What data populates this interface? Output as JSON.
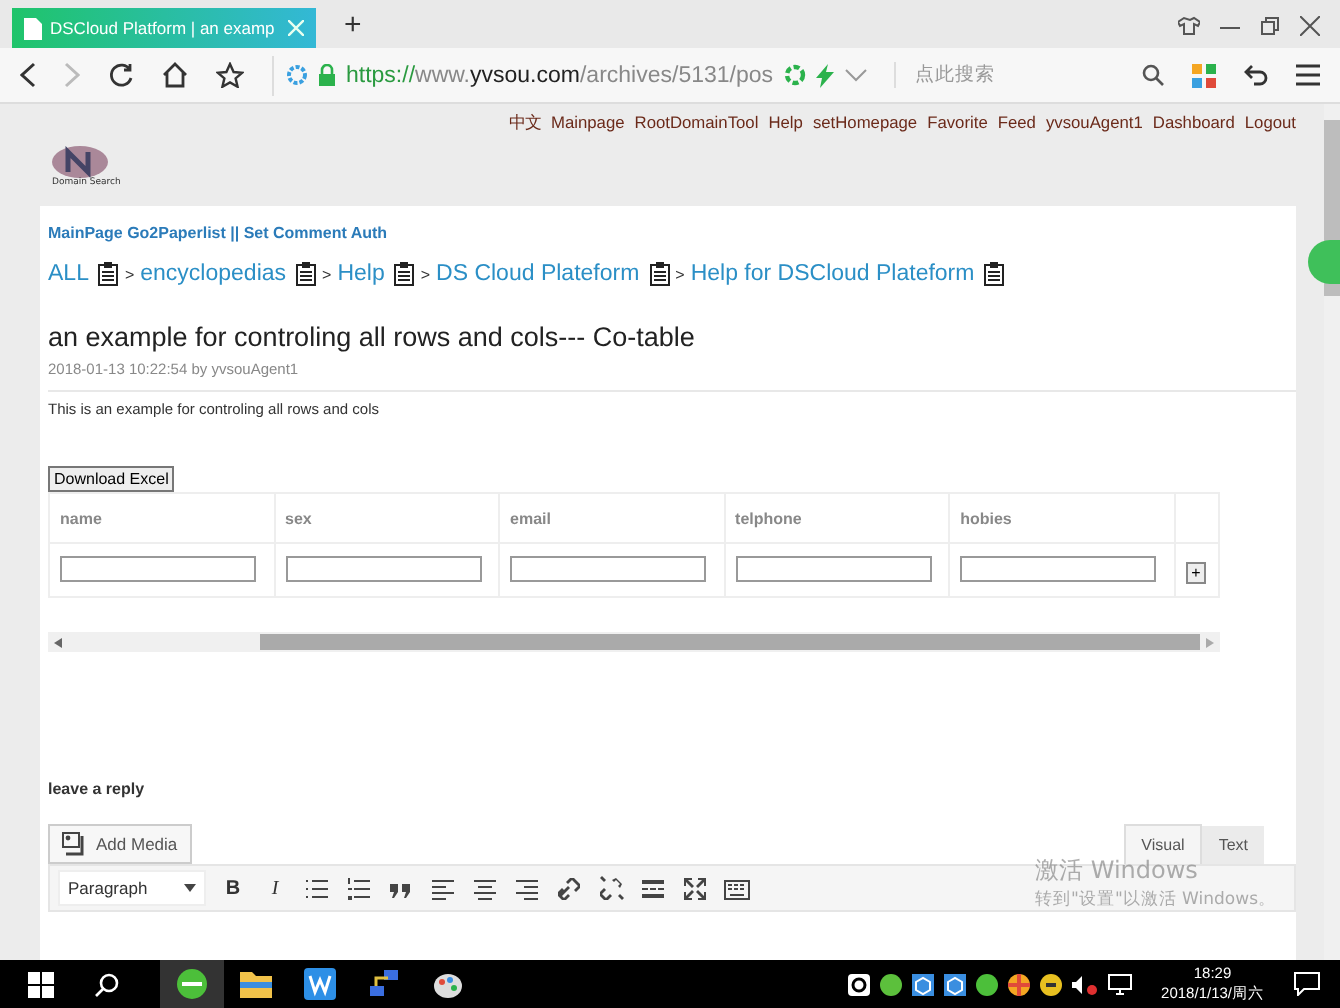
{
  "browser": {
    "tab_title": "DSCloud Platform | an examp",
    "new_tab": "+",
    "url": {
      "scheme": "https://",
      "prefix": "www.",
      "domain": "yvsou.com",
      "path": "/archives/5131/pos"
    },
    "search_placeholder": "点此搜索"
  },
  "nav_links": [
    "中文",
    "Mainpage",
    "RootDomainTool",
    "Help",
    "setHomepage",
    "Favorite",
    "Feed",
    "yvsouAgent1",
    "Dashboard",
    "Logout"
  ],
  "logo": {
    "caption": "Domain Search"
  },
  "top_links": "MainPage Go2Paperlist || Set Comment Auth",
  "breadcrumb": {
    "separator": ">",
    "items": [
      "ALL",
      "encyclopedias",
      "Help",
      "DS Cloud Plateform",
      "Help for DSCloud Plateform"
    ]
  },
  "post": {
    "title": "an example for controling all rows and cols--- Co-table",
    "meta": "2018-01-13 10:22:54 by yvsouAgent1",
    "description": "This is an example for controling all rows and cols"
  },
  "download_button": "Download Excel",
  "table": {
    "columns": [
      "name",
      "sex",
      "email",
      "telphone",
      "hobies"
    ],
    "rows": [
      {
        "cells": [
          "",
          "",
          "",
          "",
          ""
        ]
      }
    ],
    "add_button": "+"
  },
  "reply": {
    "heading": "leave a reply",
    "add_media": "Add Media",
    "tabs": [
      {
        "label": "Visual",
        "selected": true
      },
      {
        "label": "Text",
        "selected": false
      }
    ],
    "format": "Paragraph",
    "tools": [
      {
        "kind": "bold",
        "label": "B"
      },
      {
        "kind": "italic",
        "label": "I"
      },
      {
        "kind": "bullets"
      },
      {
        "kind": "numbers"
      },
      {
        "kind": "quote"
      },
      {
        "kind": "align-left"
      },
      {
        "kind": "align-center"
      },
      {
        "kind": "align-right"
      },
      {
        "kind": "link"
      },
      {
        "kind": "unlink"
      },
      {
        "kind": "more"
      },
      {
        "kind": "fullscreen"
      },
      {
        "kind": "keyboard"
      }
    ]
  },
  "activation": {
    "title": "激活 Windows",
    "hint": "转到\"设置\"以激活 Windows。"
  },
  "taskbar": {
    "time": "18:29",
    "date": "2018/1/13/周六"
  }
}
